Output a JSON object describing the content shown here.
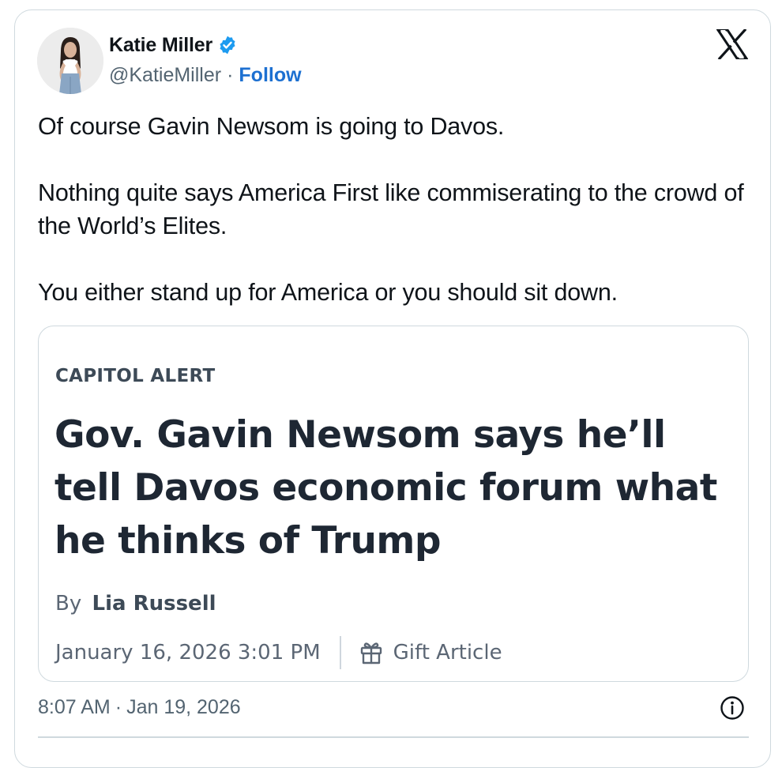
{
  "author": {
    "display_name": "Katie Miller",
    "handle": "@KatieMiller",
    "separator": "·",
    "follow_label": "Follow",
    "verified_icon": "verified-badge-icon",
    "badge_color": "#1d9bf0"
  },
  "platform_icon": "x-logo-icon",
  "tweet": {
    "paragraphs": [
      "Of course Gavin Newsom is going to Davos.",
      "Nothing quite says America First like commiserating to the crowd of the World’s Elites.",
      "You either stand up for America or you should sit down."
    ]
  },
  "article_card": {
    "kicker": "CAPITOL ALERT",
    "headline": "Gov. Gavin Newsom says he’ll tell Davos economic forum what he thinks of Trump",
    "byline_prefix": "By",
    "byline_author": "Lia Russell",
    "date": "January 16, 2026 3:01 PM",
    "gift_label": "Gift Article",
    "gift_icon": "gift-icon"
  },
  "footer": {
    "time": "8:07 AM",
    "separator": "·",
    "date": "Jan 19, 2026",
    "info_icon": "info-icon"
  },
  "colors": {
    "link_blue": "#1d70d1",
    "text_primary": "#0f1419",
    "text_secondary": "#536471",
    "border": "#cfd9de"
  }
}
